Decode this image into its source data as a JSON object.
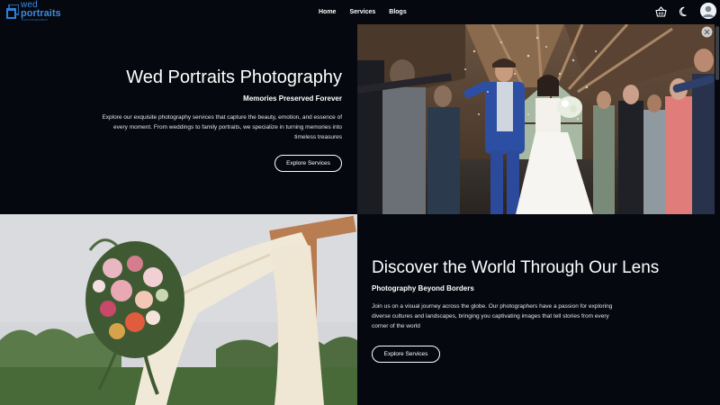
{
  "brand": {
    "logo_top": "wed",
    "logo_main": "portraits",
    "logo_sub": "PHOTOGRAPHY"
  },
  "nav": {
    "links": [
      "Home",
      "Services",
      "Blogs"
    ]
  },
  "header_icons": {
    "basket": "basket-icon",
    "theme": "moon-icon",
    "account": "avatar"
  },
  "hero": {
    "title": "Wed Portraits Photography",
    "subtitle": "Memories Preserved Forever",
    "description": "Explore our exquisite photography services that capture the beauty, emotion, and essence of every moment. From weddings to family portraits, we specialize in turning memories into timeless treasures",
    "cta": "Explore Services",
    "image": "wedding-couple-photo"
  },
  "discover": {
    "title": "Discover the World Through Our Lens",
    "subtitle": "Photography Beyond Borders",
    "description": "Join us on a visual journey across the globe. Our photographers have a passion for exploring diverse cultures and landscapes, bringing you captivating images that tell stories from every corner of the world",
    "cta": "Explore Services",
    "image": "wedding-arch-flowers-photo"
  },
  "colors": {
    "background": "#05080f",
    "brand_blue": "#3a8ce0",
    "text": "#ffffff"
  }
}
